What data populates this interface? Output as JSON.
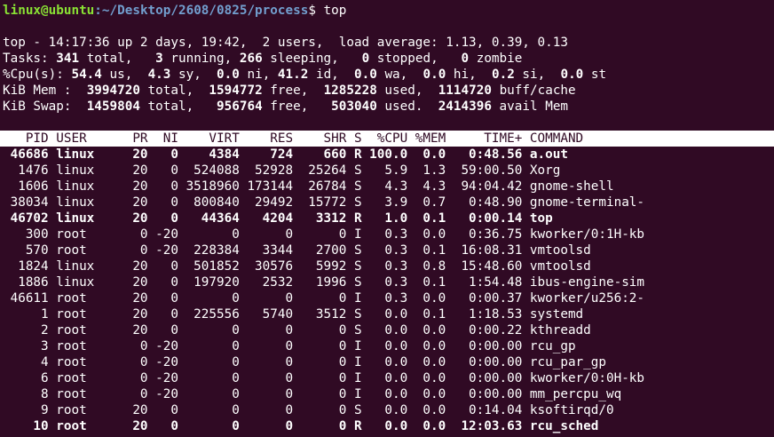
{
  "prompt": {
    "user_host": "linux@ubuntu",
    "path": ":~/Desktop/2608/0825/process",
    "suffix": "$ ",
    "command": "top"
  },
  "summary": {
    "top_line": "top - 14:17:36 up 2 days, 19:42,  2 users,  load average: 1.13, 0.39, 0.13",
    "tasks": {
      "label": "Tasks: ",
      "total": "341",
      "total_label": " total,   ",
      "running": "3",
      "running_label": " running, ",
      "sleeping": "266",
      "sleeping_label": " sleeping,   ",
      "stopped": "0",
      "stopped_label": " stopped,   ",
      "zombie": "0",
      "zombie_label": " zombie"
    },
    "cpu": {
      "label": "%Cpu(s): ",
      "us": "54.4",
      "us_label": " us,  ",
      "sy": "4.3",
      "sy_label": " sy,  ",
      "ni": "0.0",
      "ni_label": " ni, ",
      "id": "41.2",
      "id_label": " id,  ",
      "wa": "0.0",
      "wa_label": " wa,  ",
      "hi": "0.0",
      "hi_label": " hi,  ",
      "si": "0.2",
      "si_label": " si,  ",
      "st": "0.0",
      "st_label": " st"
    },
    "mem": {
      "label": "KiB Mem :  ",
      "total": "3994720",
      "total_label": " total,  ",
      "free": "1594772",
      "free_label": " free,  ",
      "used": "1285228",
      "used_label": " used,  ",
      "cache": "1114720",
      "cache_label": " buff/cache"
    },
    "swap": {
      "label": "KiB Swap:  ",
      "total": "1459804",
      "total_label": " total,   ",
      "free": "956764",
      "free_label": " free,   ",
      "used": "503040",
      "used_label": " used.  ",
      "avail": "2414396",
      "avail_label": " avail Mem"
    }
  },
  "table": {
    "header": "   PID USER      PR  NI    VIRT    RES    SHR S  %CPU %MEM     TIME+ COMMAND",
    "rows": [
      {
        "text": " 46686 linux     20   0    4384    724    660 R 100.0  0.0   0:48.56 a.out",
        "bold": true
      },
      {
        "text": "  1476 linux     20   0  524088  52928  25264 S   5.9  1.3  59:00.50 Xorg",
        "bold": false
      },
      {
        "text": "  1606 linux     20   0 3518960 173144  26784 S   4.3  4.3  94:04.42 gnome-shell",
        "bold": false
      },
      {
        "text": " 38034 linux     20   0  800840  29492  15772 S   3.9  0.7   0:48.90 gnome-terminal-",
        "bold": false
      },
      {
        "text": " 46702 linux     20   0   44364   4204   3312 R   1.0  0.1   0:00.14 top",
        "bold": true
      },
      {
        "text": "   300 root       0 -20       0      0      0 I   0.3  0.0   0:36.75 kworker/0:1H-kb",
        "bold": false
      },
      {
        "text": "   570 root       0 -20  228384   3344   2700 S   0.3  0.1  16:08.31 vmtoolsd",
        "bold": false
      },
      {
        "text": "  1824 linux     20   0  501852  30576   5992 S   0.3  0.8  15:48.60 vmtoolsd",
        "bold": false
      },
      {
        "text": "  1886 linux     20   0  197920   2532   1996 S   0.3  0.1   1:54.48 ibus-engine-sim",
        "bold": false
      },
      {
        "text": " 46611 root      20   0       0      0      0 I   0.3  0.0   0:00.37 kworker/u256:2-",
        "bold": false
      },
      {
        "text": "     1 root      20   0  225556   5740   3512 S   0.0  0.1   1:18.53 systemd",
        "bold": false
      },
      {
        "text": "     2 root      20   0       0      0      0 S   0.0  0.0   0:00.22 kthreadd",
        "bold": false
      },
      {
        "text": "     3 root       0 -20       0      0      0 I   0.0  0.0   0:00.00 rcu_gp",
        "bold": false
      },
      {
        "text": "     4 root       0 -20       0      0      0 I   0.0  0.0   0:00.00 rcu_par_gp",
        "bold": false
      },
      {
        "text": "     6 root       0 -20       0      0      0 I   0.0  0.0   0:00.00 kworker/0:0H-kb",
        "bold": false
      },
      {
        "text": "     8 root       0 -20       0      0      0 I   0.0  0.0   0:00.00 mm_percpu_wq",
        "bold": false
      },
      {
        "text": "     9 root      20   0       0      0      0 S   0.0  0.0   0:14.04 ksoftirqd/0",
        "bold": false
      },
      {
        "text": "    10 root      20   0       0      0      0 R   0.0  0.0  12:03.63 rcu_sched",
        "bold": true
      }
    ]
  },
  "colors": {
    "background": "#300a24",
    "prompt_user": "#8ae234",
    "prompt_path": "#729fcf",
    "header_bar": "#ffffff"
  }
}
